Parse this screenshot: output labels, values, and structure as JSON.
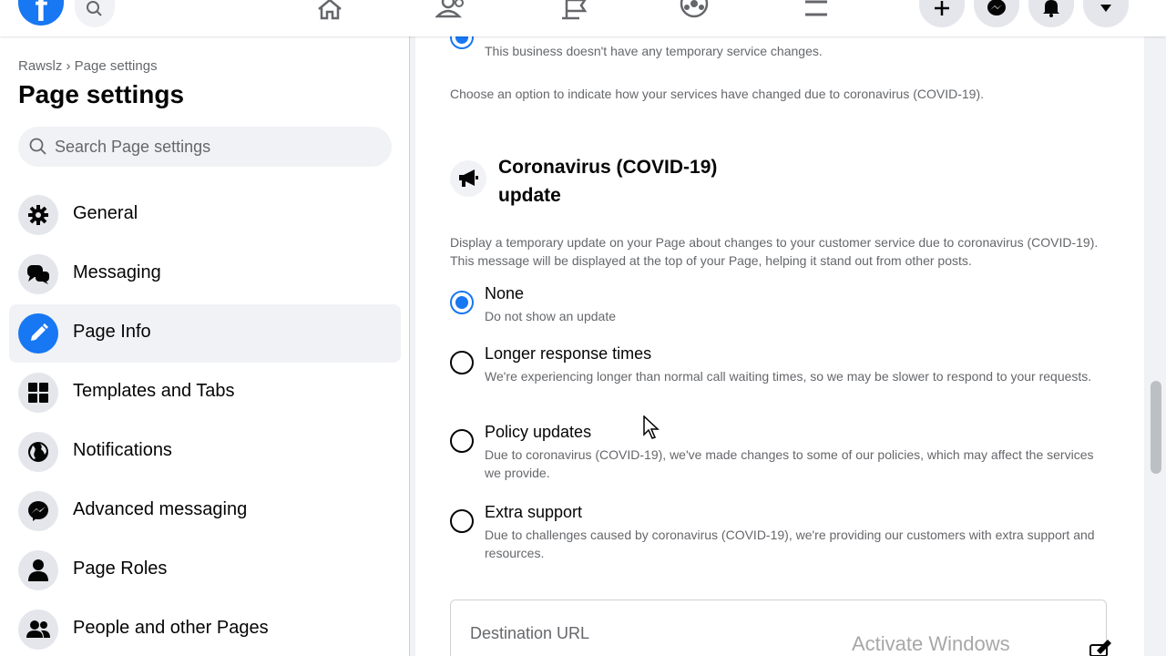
{
  "topnav": {
    "logo_letter": "f",
    "icons": [
      "facebook-logo",
      "search-icon",
      "home-icon",
      "friends-icon",
      "flag-icon",
      "groups-icon",
      "menu-icon",
      "plus-icon",
      "messenger-icon",
      "bell-icon",
      "caret-down-icon"
    ]
  },
  "sidebar": {
    "breadcrumb": "Rawslz › Page settings",
    "title": "Page settings",
    "search_placeholder": "Search Page settings",
    "items": [
      {
        "label": "General",
        "icon": "gear-icon"
      },
      {
        "label": "Messaging",
        "icon": "chat-icon"
      },
      {
        "label": "Page Info",
        "icon": "pencil-icon",
        "active": true
      },
      {
        "label": "Templates and Tabs",
        "icon": "grid-icon"
      },
      {
        "label": "Notifications",
        "icon": "globe-icon"
      },
      {
        "label": "Advanced messaging",
        "icon": "messenger-icon"
      },
      {
        "label": "Page Roles",
        "icon": "person-icon"
      },
      {
        "label": "People and other Pages",
        "icon": "people-icon"
      }
    ]
  },
  "main": {
    "top_option_desc": "This business doesn't have any temporary service changes.",
    "service_hint": "Choose an option to indicate how your services have changed due to coronavirus (COVID-19).",
    "section": {
      "icon": "megaphone-icon",
      "title": "Coronavirus (COVID-19) update",
      "description": "Display a temporary update on your Page about changes to your customer service due to coronavirus (COVID-19). This message will be displayed at the top of your Page, helping it stand out from other posts."
    },
    "options": [
      {
        "title": "None",
        "desc": "Do not show an update",
        "selected": true
      },
      {
        "title": "Longer response times",
        "desc": "We're experiencing longer than normal call waiting times, so we may be slower to respond to your requests."
      },
      {
        "title": "Policy updates",
        "desc": "Due to coronavirus (COVID-19), we've made changes to some of our policies, which may affect the services we provide."
      },
      {
        "title": "Extra support",
        "desc": "Due to challenges caused by coronavirus (COVID-19), we're providing our customers with extra support and resources."
      }
    ],
    "destination_label": "Destination URL"
  },
  "watermark": "Activate Windows",
  "colors": {
    "accent": "#1877f2",
    "background": "#f0f2f5",
    "secondary_text": "#65676b"
  }
}
